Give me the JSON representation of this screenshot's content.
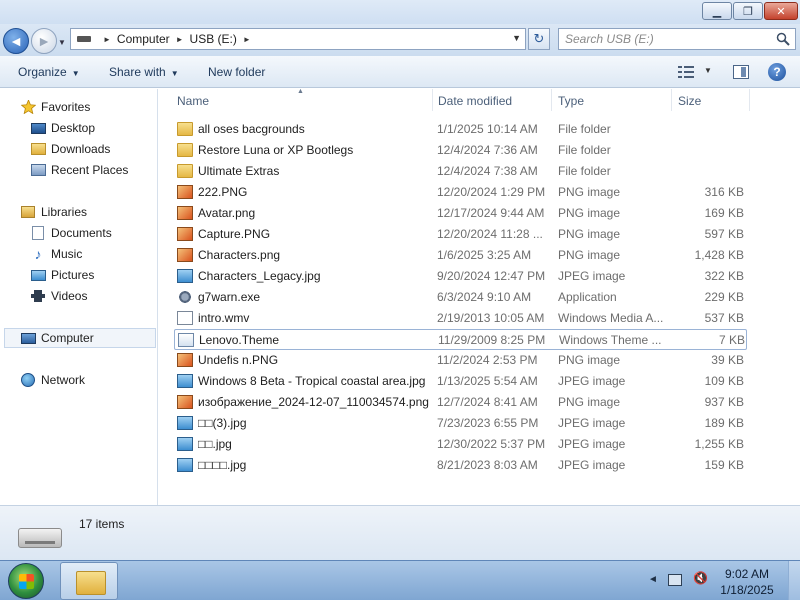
{
  "window": {
    "minimize_label": "▁",
    "maximize_label": "❐",
    "close_label": "✕"
  },
  "nav": {
    "back_glyph": "◄",
    "forward_glyph": "►",
    "history_glyph": "▼",
    "refresh_glyph": "↻"
  },
  "address": {
    "crumbs": [
      "Computer",
      "USB (E:)"
    ],
    "separator": "►",
    "dropdown_glyph": "▼"
  },
  "search": {
    "placeholder": "Search USB (E:)"
  },
  "toolbar": {
    "organize_label": "Organize",
    "share_label": "Share with",
    "newfolder_label": "New folder",
    "arrow": "▼"
  },
  "navpane": {
    "favorites": "Favorites",
    "desktop": "Desktop",
    "downloads": "Downloads",
    "recent": "Recent Places",
    "libraries": "Libraries",
    "documents": "Documents",
    "music": "Music",
    "pictures": "Pictures",
    "videos": "Videos",
    "computer": "Computer",
    "network": "Network"
  },
  "columns": {
    "name": "Name",
    "date": "Date modified",
    "type": "Type",
    "size": "Size"
  },
  "files": [
    {
      "name": "all oses bacgrounds",
      "date": "1/1/2025 10:14 AM",
      "type": "File folder",
      "size": "",
      "icon": "folder-icon"
    },
    {
      "name": "Restore Luna or XP Bootlegs",
      "date": "12/4/2024 7:36 AM",
      "type": "File folder",
      "size": "",
      "icon": "folder-icon"
    },
    {
      "name": "Ultimate Extras",
      "date": "12/4/2024 7:38 AM",
      "type": "File folder",
      "size": "",
      "icon": "folder-icon"
    },
    {
      "name": "222.PNG",
      "date": "12/20/2024 1:29 PM",
      "type": "PNG image",
      "size": "316 KB",
      "icon": "png-file-icon"
    },
    {
      "name": "Avatar.png",
      "date": "12/17/2024 9:44 AM",
      "type": "PNG image",
      "size": "169 KB",
      "icon": "png-file-icon"
    },
    {
      "name": "Capture.PNG",
      "date": "12/20/2024 11:28 ...",
      "type": "PNG image",
      "size": "597 KB",
      "icon": "png-file-icon"
    },
    {
      "name": "Characters.png",
      "date": "1/6/2025 3:25 AM",
      "type": "PNG image",
      "size": "1,428 KB",
      "icon": "png-file-icon"
    },
    {
      "name": "Characters_Legacy.jpg",
      "date": "9/20/2024 12:47 PM",
      "type": "JPEG image",
      "size": "322 KB",
      "icon": "jpeg-file-icon"
    },
    {
      "name": "g7warn.exe",
      "date": "6/3/2024 9:10 AM",
      "type": "Application",
      "size": "229 KB",
      "icon": "application-icon"
    },
    {
      "name": "intro.wmv",
      "date": "2/19/2013 10:05 AM",
      "type": "Windows Media A...",
      "size": "537 KB",
      "icon": "video-file-icon"
    },
    {
      "name": "Lenovo.Theme",
      "date": "11/29/2009 8:25 PM",
      "type": "Windows Theme ...",
      "size": "7 KB",
      "icon": "theme-file-icon"
    },
    {
      "name": "Undefis n.PNG",
      "date": "11/2/2024 2:53 PM",
      "type": "PNG image",
      "size": "39 KB",
      "icon": "png-file-icon"
    },
    {
      "name": "Windows 8 Beta - Tropical coastal area.jpg",
      "date": "1/13/2025 5:54 AM",
      "type": "JPEG image",
      "size": "109 KB",
      "icon": "jpeg-file-icon"
    },
    {
      "name": "изображение_2024-12-07_110034574.png",
      "date": "12/7/2024 8:41 AM",
      "type": "PNG image",
      "size": "937 KB",
      "icon": "png-file-icon"
    },
    {
      "name": "□□(3).jpg",
      "date": "7/23/2023 6:55 PM",
      "type": "JPEG image",
      "size": "189 KB",
      "icon": "jpeg-file-icon"
    },
    {
      "name": "□□.jpg",
      "date": "12/30/2022 5:37 PM",
      "type": "JPEG image",
      "size": "1,255 KB",
      "icon": "jpeg-file-icon"
    },
    {
      "name": "□□□□.jpg",
      "date": "8/21/2023 8:03 AM",
      "type": "JPEG image",
      "size": "159 KB",
      "icon": "jpeg-file-icon"
    }
  ],
  "details": {
    "items_count": "17 items"
  },
  "taskbar": {
    "time": "9:02 AM",
    "date": "1/18/2025",
    "tray_arrow": "◄",
    "volume_glyph": "🔇"
  },
  "colors": {
    "accent": "#2a63b7",
    "titlebar": "#cfdff2",
    "taskbar": "#7fa6d2",
    "selection_border": "#9ab3d6",
    "secondary_text": "#6d6d6d"
  }
}
